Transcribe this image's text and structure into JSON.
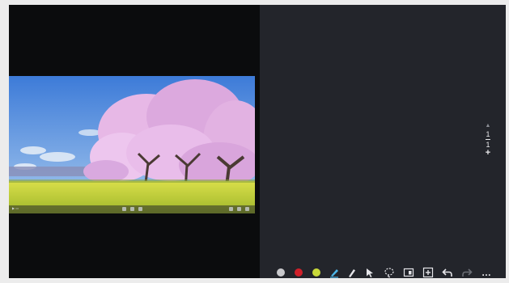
{
  "pager": {
    "current": "1",
    "total": "1",
    "add": "+"
  },
  "toolbar": {
    "colors": [
      "#c9c9cc",
      "#d0202a",
      "#c8d93a"
    ],
    "tools": [
      "pen-icon",
      "marker-icon",
      "select-cursor-icon",
      "lasso-icon",
      "slides-icon",
      "insert-icon",
      "undo-icon",
      "redo-icon",
      "more-icon"
    ],
    "more_label": "…"
  },
  "colors": {
    "accent": "#4a9ad6",
    "panel": "#23252b"
  }
}
